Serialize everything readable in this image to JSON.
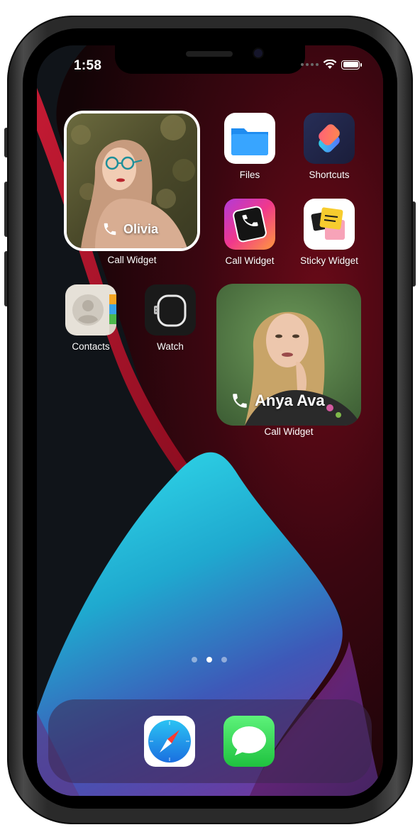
{
  "status_bar": {
    "time": "1:58"
  },
  "widgets": {
    "top_left": {
      "name": "Olivia",
      "label": "Call Widget"
    },
    "right": {
      "name": "Anya Ava",
      "label": "Call Widget"
    }
  },
  "apps": {
    "files": {
      "label": "Files",
      "icon": "files-folder-icon"
    },
    "shortcuts": {
      "label": "Shortcuts",
      "icon": "shortcuts-icon"
    },
    "call_widget": {
      "label": "Call Widget",
      "icon": "phone-handset-icon"
    },
    "sticky_widget": {
      "label": "Sticky Widget",
      "icon": "sticky-notes-icon"
    },
    "contacts": {
      "label": "Contacts",
      "icon": "contacts-icon"
    },
    "watch": {
      "label": "Watch",
      "icon": "watch-icon"
    }
  },
  "page_indicator": {
    "count": 3,
    "active_index": 1
  },
  "dock": {
    "items": [
      {
        "app": "Safari",
        "icon": "safari-compass-icon"
      },
      {
        "app": "Messages",
        "icon": "messages-bubble-icon"
      }
    ]
  },
  "colors": {
    "wallpaper_red": "#b3102a",
    "wallpaper_cyan": "#20c3da",
    "wallpaper_purple": "#6a3aa0",
    "files_blue": "#1e8cf0",
    "messages_green": "#34c759"
  }
}
